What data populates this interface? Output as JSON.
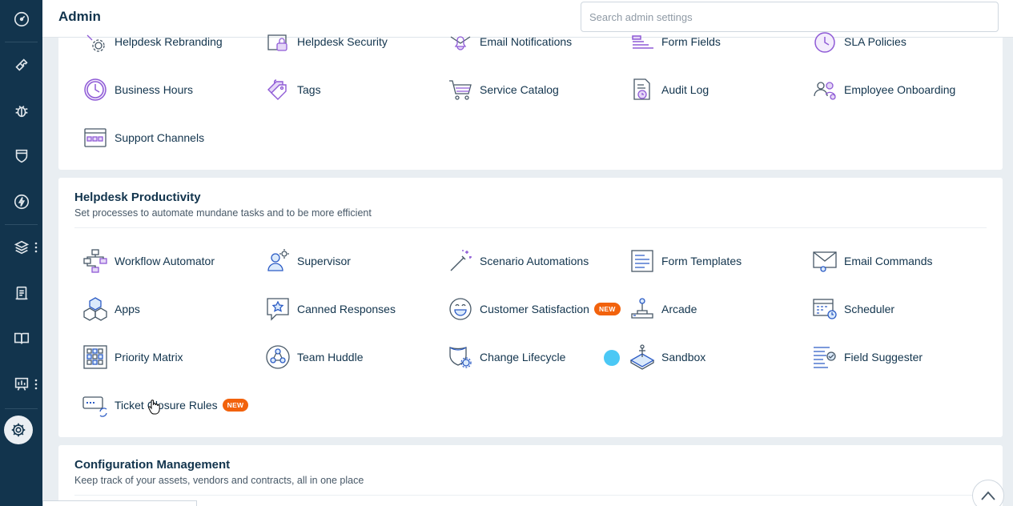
{
  "header": {
    "title": "Admin",
    "search_placeholder": "Search admin settings"
  },
  "top_section": {
    "items": [
      {
        "label": "Helpdesk Rebranding",
        "icon": "gear-brush-icon"
      },
      {
        "label": "Helpdesk Security",
        "icon": "security-icon"
      },
      {
        "label": "Email Notifications",
        "icon": "bell-icon"
      },
      {
        "label": "Form Fields",
        "icon": "form-fields-icon"
      },
      {
        "label": "SLA Policies",
        "icon": "clock-icon"
      },
      {
        "label": "Business Hours",
        "icon": "clock-icon"
      },
      {
        "label": "Tags",
        "icon": "tags-icon"
      },
      {
        "label": "Service Catalog",
        "icon": "cart-icon"
      },
      {
        "label": "Audit Log",
        "icon": "audit-log-icon"
      },
      {
        "label": "Employee Onboarding",
        "icon": "users-icon"
      },
      {
        "label": "Support Channels",
        "icon": "window-icon"
      }
    ]
  },
  "productivity": {
    "title": "Helpdesk Productivity",
    "subtitle": "Set processes to automate mundane tasks and to be more efficient",
    "items": [
      {
        "label": "Workflow Automator",
        "icon": "workflow-icon"
      },
      {
        "label": "Supervisor",
        "icon": "supervisor-icon"
      },
      {
        "label": "Scenario Automations",
        "icon": "magic-wand-icon"
      },
      {
        "label": "Form Templates",
        "icon": "form-templates-icon"
      },
      {
        "label": "Email Commands",
        "icon": "envelope-icon"
      },
      {
        "label": "Apps",
        "icon": "cubes-icon"
      },
      {
        "label": "Canned Responses",
        "icon": "canned-response-icon"
      },
      {
        "label": "Customer Satisfaction",
        "icon": "smiley-icon",
        "badge": "NEW"
      },
      {
        "label": "Arcade",
        "icon": "joystick-icon"
      },
      {
        "label": "Scheduler",
        "icon": "calendar-icon"
      },
      {
        "label": "Priority Matrix",
        "icon": "grid-icon"
      },
      {
        "label": "Team Huddle",
        "icon": "team-huddle-icon"
      },
      {
        "label": "Change Lifecycle",
        "icon": "change-lifecycle-icon"
      },
      {
        "label": "Sandbox",
        "icon": "sandbox-icon"
      },
      {
        "label": "Field Suggester",
        "icon": "field-suggester-icon"
      },
      {
        "label": "Ticket Closure Rules",
        "icon": "ticket-closure-icon",
        "badge": "NEW"
      }
    ]
  },
  "config": {
    "title": "Configuration Management",
    "subtitle": "Keep track of your assets, vendors and contracts, all in one place"
  },
  "colors": {
    "nav_bg": "#12344d",
    "accent_purple": "#8f5bd6",
    "badge_orange": "#f2620c",
    "dot_blue": "#4bc8f5"
  }
}
